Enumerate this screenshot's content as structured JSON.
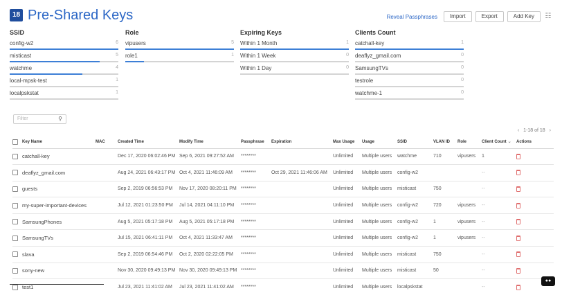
{
  "header": {
    "count": "18",
    "title": "Pre-Shared Keys",
    "reveal_label": "Reveal Passphrases",
    "import_label": "Import",
    "export_label": "Export",
    "add_label": "Add Key",
    "filter_icon": "columns-icon"
  },
  "summary": {
    "ssid": {
      "title": "SSID",
      "items": [
        {
          "label": "config-w2",
          "count": "6",
          "fraction": 1.0
        },
        {
          "label": "misticast",
          "count": "5",
          "fraction": 0.83
        },
        {
          "label": "watchme",
          "count": "4",
          "fraction": 0.67
        },
        {
          "label": "local-mpsk-test",
          "count": "1",
          "fraction": 0.0
        },
        {
          "label": "localpskstat",
          "count": "1",
          "fraction": 0.0
        }
      ]
    },
    "role": {
      "title": "Role",
      "items": [
        {
          "label": "vipusers",
          "count": "5",
          "fraction": 1.0
        },
        {
          "label": "role1",
          "count": "1",
          "fraction": 0.17
        }
      ]
    },
    "expiring": {
      "title": "Expiring Keys",
      "items": [
        {
          "label": "Within 1 Month",
          "count": "1",
          "fraction": 1.0
        },
        {
          "label": "Within 1 Week",
          "count": "0",
          "fraction": 0.0
        },
        {
          "label": "Within 1 Day",
          "count": "0",
          "fraction": 0.0
        }
      ]
    },
    "clients": {
      "title": "Clients Count",
      "items": [
        {
          "label": "catchall-key",
          "count": "1",
          "fraction": 1.0
        },
        {
          "label": "deaflyz_gmail.com",
          "count": "0",
          "fraction": 0.0
        },
        {
          "label": "SamsungTVs",
          "count": "0",
          "fraction": 0.0
        },
        {
          "label": "testrole",
          "count": "0",
          "fraction": 0.0
        },
        {
          "label": "watchme-1",
          "count": "0",
          "fraction": 0.0
        }
      ]
    }
  },
  "filter": {
    "placeholder": "Filter"
  },
  "pager": {
    "prev": "‹",
    "text": "1-18 of 18",
    "next": "›"
  },
  "table": {
    "columns": [
      "Key Name",
      "MAC",
      "Created Time",
      "Modify Time",
      "Passphrase",
      "Expiration",
      "Max Usage",
      "Usage",
      "SSID",
      "VLAN ID",
      "Role",
      "Client Count",
      "Actions"
    ],
    "rows": [
      {
        "name": "catchall-key",
        "mac": "",
        "created": "Dec 17, 2020 06:02:46 PM",
        "modified": "Sep 6, 2021 09:27:52 AM",
        "pass": "********",
        "exp": "",
        "max": "Unlimited",
        "usage": "Multiple users",
        "ssid": "watchme",
        "vlan": "710",
        "role": "vipusers",
        "clients": "1"
      },
      {
        "name": "deaflyz_gmail.com",
        "mac": "",
        "created": "Aug 24, 2021 06:43:17 PM",
        "modified": "Oct 4, 2021 11:46:09 AM",
        "pass": "********",
        "exp": "Oct 29, 2021 11:46:06 AM",
        "max": "Unlimited",
        "usage": "Multiple users",
        "ssid": "config-w2",
        "vlan": "",
        "role": "",
        "clients": "--"
      },
      {
        "name": "guests",
        "mac": "",
        "created": "Sep 2, 2019 06:56:53 PM",
        "modified": "Nov 17, 2020 08:20:11 PM",
        "pass": "********",
        "exp": "",
        "max": "Unlimited",
        "usage": "Multiple users",
        "ssid": "misticast",
        "vlan": "750",
        "role": "",
        "clients": "--"
      },
      {
        "name": "my-super-important-devices",
        "mac": "",
        "created": "Jul 12, 2021 01:23:50 PM",
        "modified": "Jul 14, 2021 04:11:10 PM",
        "pass": "********",
        "exp": "",
        "max": "Unlimited",
        "usage": "Multiple users",
        "ssid": "config-w2",
        "vlan": "720",
        "role": "vipusers",
        "clients": "--"
      },
      {
        "name": "SamsungPhones",
        "mac": "",
        "created": "Aug 5, 2021 05:17:18 PM",
        "modified": "Aug 5, 2021 05:17:18 PM",
        "pass": "********",
        "exp": "",
        "max": "Unlimited",
        "usage": "Multiple users",
        "ssid": "config-w2",
        "vlan": "1",
        "role": "vipusers",
        "clients": "--"
      },
      {
        "name": "SamsungTVs",
        "mac": "",
        "created": "Jul 15, 2021 06:41:11 PM",
        "modified": "Oct 4, 2021 11:33:47 AM",
        "pass": "********",
        "exp": "",
        "max": "Unlimited",
        "usage": "Multiple users",
        "ssid": "config-w2",
        "vlan": "1",
        "role": "vipusers",
        "clients": "--"
      },
      {
        "name": "slava",
        "mac": "",
        "created": "Sep 2, 2019 06:54:46 PM",
        "modified": "Oct 2, 2020 02:22:05 PM",
        "pass": "********",
        "exp": "",
        "max": "Unlimited",
        "usage": "Multiple users",
        "ssid": "misticast",
        "vlan": "750",
        "role": "",
        "clients": "--"
      },
      {
        "name": "sony-new",
        "mac": "",
        "created": "Nov 30, 2020 09:49:13 PM",
        "modified": "Nov 30, 2020 09:49:13 PM",
        "pass": "********",
        "exp": "",
        "max": "Unlimited",
        "usage": "Multiple users",
        "ssid": "misticast",
        "vlan": "50",
        "role": "",
        "clients": "--"
      },
      {
        "name": "test1",
        "mac": "",
        "created": "Jul 23, 2021 11:41:02 AM",
        "modified": "Jul 23, 2021 11:41:02 AM",
        "pass": "********",
        "exp": "",
        "max": "Unlimited",
        "usage": "Multiple users",
        "ssid": "localpskstat",
        "vlan": "",
        "role": "",
        "clients": "--"
      }
    ]
  },
  "colors": {
    "accent": "#2c67c6",
    "badge": "#1f4d9d",
    "bar_fill": "#3d7fd6",
    "delete": "#e07070"
  }
}
